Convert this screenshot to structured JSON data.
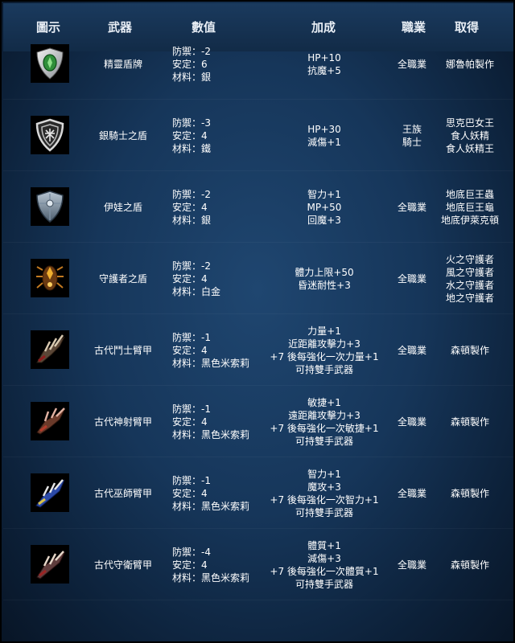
{
  "headers": {
    "icon": "圖示",
    "weapon": "武器",
    "stats": "數值",
    "bonus": "加成",
    "class": "職業",
    "obtain": "取得"
  },
  "rows": [
    {
      "icon": "silver-green-shield-icon",
      "name": "精靈盾牌",
      "stats": [
        "防禦：-2",
        "安定：6",
        "材料：銀"
      ],
      "bonus": [
        "HP+10",
        "抗魔+5"
      ],
      "class": [
        "全職業"
      ],
      "obtain": [
        "娜魯帕製作"
      ]
    },
    {
      "icon": "silver-knight-shield-icon",
      "name": "銀騎士之盾",
      "stats": [
        "防禦：-3",
        "安定：4",
        "材料：鐵"
      ],
      "bonus": [
        "HP+30",
        "減傷+1"
      ],
      "class": [
        "王族",
        "騎士"
      ],
      "obtain": [
        "思克巴女王",
        "食人妖精",
        "食人妖精王"
      ]
    },
    {
      "icon": "steel-shield-icon",
      "name": "伊娃之盾",
      "stats": [
        "防禦：-2",
        "安定：4",
        "材料：銀"
      ],
      "bonus": [
        "智力+1",
        "MP+50",
        "回魔+3"
      ],
      "class": [
        "全職業"
      ],
      "obtain": [
        "地底巨王蟲",
        "地底巨王龜",
        "地底伊萊克頓"
      ]
    },
    {
      "icon": "guardian-shield-icon",
      "name": "守護者之盾",
      "stats": [
        "防禦：-2",
        "安定：4",
        "材料：白金"
      ],
      "bonus": [
        "體力上限+50",
        "昏迷耐性+3"
      ],
      "class": [
        "全職業"
      ],
      "obtain": [
        "火之守護者",
        "風之守護者",
        "水之守護者",
        "地之守護者"
      ]
    },
    {
      "icon": "gladiator-bracer-icon",
      "name": "古代鬥士臂甲",
      "stats": [
        "防禦：-1",
        "安定：4",
        "材料：黑色米索莉"
      ],
      "bonus": [
        "力量+1",
        "近距離攻擊力+3",
        "+7 後每強化一次力量+1",
        "可持雙手武器"
      ],
      "class": [
        "全職業"
      ],
      "obtain": [
        "森頓製作"
      ]
    },
    {
      "icon": "archer-bracer-icon",
      "name": "古代神射臂甲",
      "stats": [
        "防禦：-1",
        "安定：4",
        "材料：黑色米索莉"
      ],
      "bonus": [
        "敏捷+1",
        "遠距離攻擊力+3",
        "+7 後每強化一次敏捷+1",
        "可持雙手武器"
      ],
      "class": [
        "全職業"
      ],
      "obtain": [
        "森頓製作"
      ]
    },
    {
      "icon": "wizard-bracer-icon",
      "name": "古代巫師臂甲",
      "stats": [
        "防禦：-1",
        "安定：4",
        "材料：黑色米索莉"
      ],
      "bonus": [
        "智力+1",
        "魔攻+3",
        "+7 後每強化一次智力+1",
        "可持雙手武器"
      ],
      "class": [
        "全職業"
      ],
      "obtain": [
        "森頓製作"
      ]
    },
    {
      "icon": "guardian-bracer-icon",
      "name": "古代守衛臂甲",
      "stats": [
        "防禦：-4",
        "安定：4",
        "材料：黑色米索莉"
      ],
      "bonus": [
        "體質+1",
        "減傷+3",
        "+7 後每強化一次體質+1",
        "可持雙手武器"
      ],
      "class": [
        "全職業"
      ],
      "obtain": [
        "森頓製作"
      ]
    }
  ]
}
